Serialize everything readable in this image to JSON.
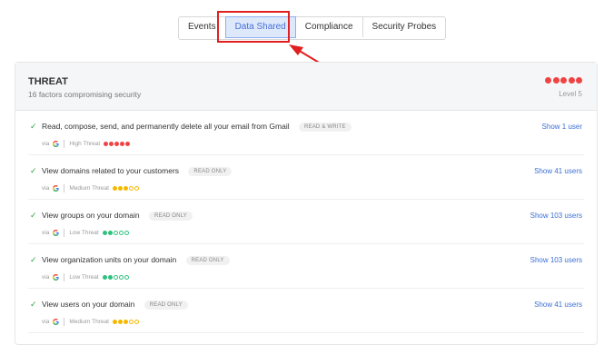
{
  "tabs": [
    {
      "label": "Events",
      "active": false
    },
    {
      "label": "Data Shared",
      "active": true
    },
    {
      "label": "Compliance",
      "active": false
    },
    {
      "label": "Security Probes",
      "active": false
    }
  ],
  "threat": {
    "title": "THREAT",
    "subtitle": "16 factors compromising security",
    "level_label": "Level 5",
    "level": 5,
    "level_color": "#ef4444"
  },
  "permissions": [
    {
      "title": "Read, compose, send, and permanently delete all your email from Gmail",
      "badge": "READ & WRITE",
      "via": "via",
      "threat_label": "High Threat",
      "threat_level": 5,
      "threat_color": "#ef4444",
      "icon": "google-icon",
      "link": "Show 1 user"
    },
    {
      "title": "View domains related to your customers",
      "badge": "READ ONLY",
      "via": "via",
      "threat_label": "Medium Threat",
      "threat_level": 3,
      "threat_color": "#f5b800",
      "icon": "google-icon",
      "link": "Show 41 users"
    },
    {
      "title": "View groups on your domain",
      "badge": "READ ONLY",
      "via": "via",
      "threat_label": "Low Threat",
      "threat_level": 2,
      "threat_color": "#2ec27e",
      "icon": "google-icon",
      "link": "Show 103 users"
    },
    {
      "title": "View organization units on your domain",
      "badge": "READ ONLY",
      "via": "via",
      "threat_label": "Low Threat",
      "threat_level": 2,
      "threat_color": "#2ec27e",
      "icon": "google-icon",
      "link": "Show 103 users"
    },
    {
      "title": "View users on your domain",
      "badge": "READ ONLY",
      "via": "via",
      "threat_label": "Medium Threat",
      "threat_level": 3,
      "threat_color": "#f5b800",
      "icon": "google-icon",
      "link": "Show 41 users"
    }
  ],
  "annotation": {
    "color": "#e02020"
  }
}
